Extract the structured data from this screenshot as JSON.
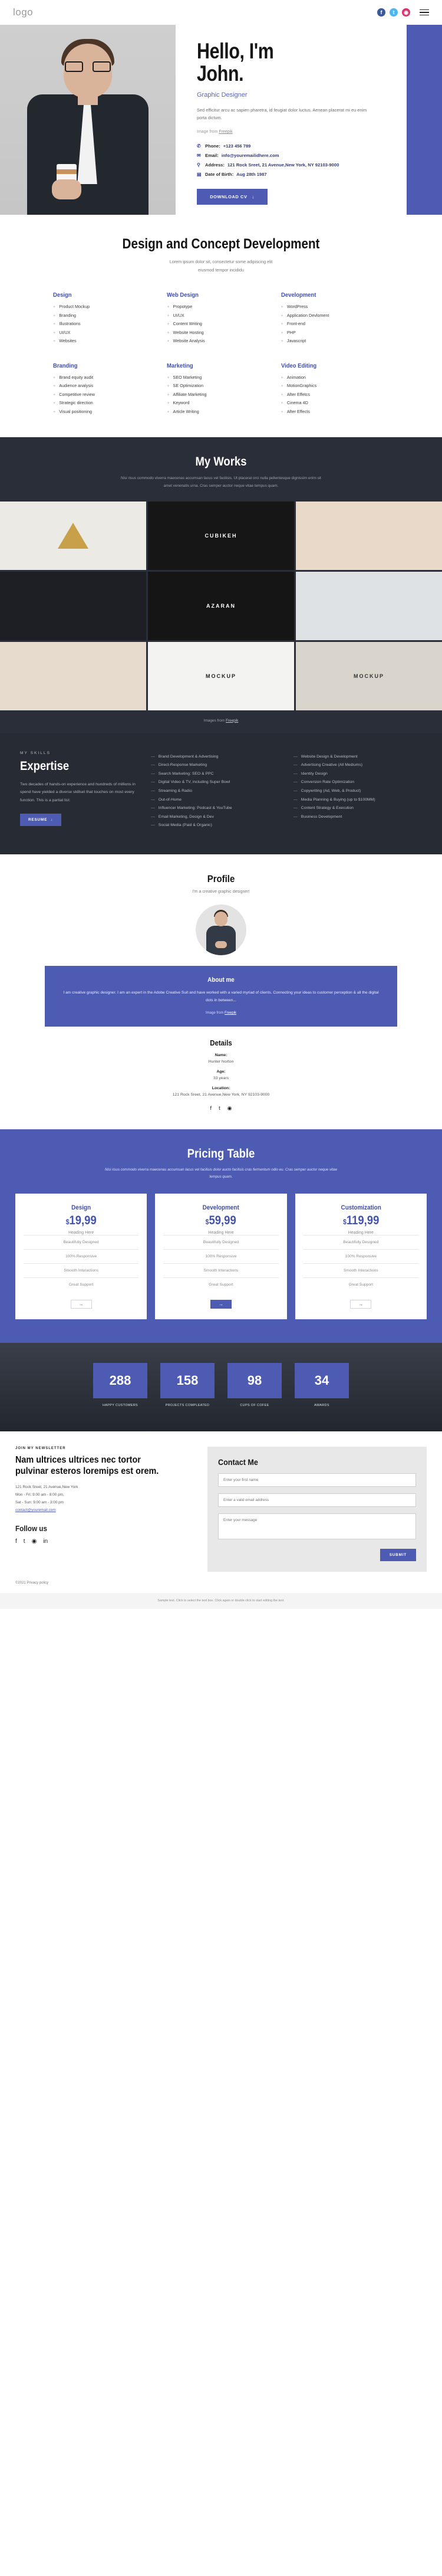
{
  "topbar": {
    "logo": "logo",
    "social": [
      {
        "name": "facebook",
        "glyph": "f"
      },
      {
        "name": "twitter",
        "glyph": "t"
      },
      {
        "name": "instagram",
        "glyph": "◉"
      }
    ],
    "menu_label": "menu"
  },
  "hero": {
    "title_line1": "Hello, I'm",
    "title_line2": "John.",
    "role": "Graphic Designer",
    "desc": "Sed efficitur arcu ac sapien pharetra, id feugiat dolor luctus. Aenean placerat mi eu enim porta dictum.",
    "credit_prefix": "Image from ",
    "credit_link": "Freepik",
    "contacts": [
      {
        "icon": "phone-icon",
        "glyph": "✆",
        "label": "Phone:",
        "value": "+123 456 789"
      },
      {
        "icon": "mail-icon",
        "glyph": "✉",
        "label": "Email:",
        "value": "info@youremailidhere.com"
      },
      {
        "icon": "pin-icon",
        "glyph": "⚲",
        "label": "Address:",
        "value": "121 Rock Sreet, 21 Avenue,New York, NY 92103-9000"
      },
      {
        "icon": "calendar-icon",
        "glyph": "▤",
        "label": "Date of Birth:",
        "value": "Aug 28th 1987"
      }
    ],
    "cta": "DOWNLOAD CV"
  },
  "services": {
    "title": "Design and Concept Development",
    "subtitle_line1": "Lorem ipsum dolor sit, consectetur some adipiscing elit",
    "subtitle_line2": "eiusmod tempor incididu",
    "groups": [
      {
        "heading": "Design",
        "items": [
          "Product Mockup",
          "Branding",
          "Illustrations",
          "UI/UX",
          "Websites"
        ]
      },
      {
        "heading": "Web Design",
        "items": [
          "Propotype",
          "UI/UX",
          "Content Writing",
          "Website Hosting",
          "Website Analysis"
        ]
      },
      {
        "heading": "Development",
        "items": [
          "WordPress",
          "Application Devloment",
          "Front-end",
          "PHP",
          "Javascript"
        ]
      },
      {
        "heading": "Branding",
        "items": [
          "Brand equity audit",
          "Audience analysis",
          "Competitive review",
          "Strategic direction",
          "Visual positioning"
        ]
      },
      {
        "heading": "Marketing",
        "items": [
          "SEO Marketing",
          "SE Optimization",
          "Affiliate Marketing",
          "Keyword",
          "Article Writing"
        ]
      },
      {
        "heading": "Video Editing",
        "items": [
          "Animation",
          "MotionGraphics",
          "After Effetcs",
          "Cinema 4D",
          "After Effects"
        ]
      }
    ]
  },
  "works": {
    "title": "My Works",
    "subtitle": "Nisi risus commodo viverra maecenas accumsan lacus vel facilisis. Ut placerat orci nulla pellentesque dignissim enim sit amet venenatis urna. Cras semper auctor neque vitae tempus quam.",
    "credit_prefix": "Images from ",
    "credit_link": "Freepik",
    "tiles": [
      {
        "name": "tile-logo-sketch",
        "caption": ""
      },
      {
        "name": "tile-cubikeh",
        "caption": "CUBIKEH"
      },
      {
        "name": "tile-leather-emboss",
        "caption": ""
      },
      {
        "name": "tile-business-cards",
        "caption": ""
      },
      {
        "name": "tile-azaran-signage",
        "caption": "AZARAN"
      },
      {
        "name": "tile-lion-badge",
        "caption": ""
      },
      {
        "name": "tile-card-mockup",
        "caption": ""
      },
      {
        "name": "tile-pen-mockup",
        "caption": "MOCKUP"
      },
      {
        "name": "tile-stationery-mockup",
        "caption": "MOCKUP"
      }
    ]
  },
  "expertise": {
    "kicker": "MY SKILLS",
    "heading": "Expertise",
    "paragraph": "Two decades of hands-on experience and hundreds of millions in spend have yielded a diverse skillset that touches on most every function. This is a partial list:",
    "button": "RESUME",
    "col_left": [
      "Brand Development & Advertising",
      "Direct-Response Marketing",
      "Search Marketing: SEO & PPC",
      "Digital Video & TV, including Super Bowl",
      "Streaming & Radio",
      "Out-of-Home",
      "Influencer Marketing: Podcast & YouTube",
      "Email Marketing, Design & Dev",
      "Social Media (Paid & Organic)"
    ],
    "col_right": [
      "Website Design & Development",
      "Advertising Creative (All Mediums)",
      "Identity Design",
      "Conversion Rate Optimization",
      "Copywriting (Ad, Web, & Product)",
      "Media Planning & Buying (up to $100MM)",
      "Content Strategy & Execution",
      "Business Development"
    ]
  },
  "profile": {
    "title": "Profile",
    "subtitle": "I'm a creative graphic designer!",
    "about_heading": "About me",
    "about_text": "I am creative graphic designer. I am an expert in the Adobe Creative Suit and have worked with a varied myriad of clients. Connecting your ideas to customer perception & all the digital dots in between...",
    "credit_prefix": "Image from ",
    "credit_link": "Freepik",
    "details_heading": "Details",
    "details": [
      {
        "key": "Name:",
        "value": "Hunter Norton"
      },
      {
        "key": "Age:",
        "value": "33 years"
      },
      {
        "key": "Location:",
        "value": "121 Rock Sreet, 21 Avenue,New York, NY 92103-9000"
      }
    ],
    "social": [
      {
        "name": "facebook-icon",
        "glyph": "f"
      },
      {
        "name": "twitter-icon",
        "glyph": "t"
      },
      {
        "name": "instagram-icon",
        "glyph": "◉"
      }
    ]
  },
  "pricing": {
    "title": "Pricing Table",
    "subtitle": "Nisi risus commodo viverra maecenas accumsan lacus vel facilisis dolor aucto facilisis cras fermentum odio eu. Cras semper auctor neque vitae tempus quam.",
    "plans": [
      {
        "name": "Design",
        "currency": "$",
        "price": "19,99",
        "heading": "Heading Here",
        "features": [
          "Beautifully Designed",
          "100% Responsive",
          "Smooth Interactions",
          "Great Support"
        ],
        "cta": "→"
      },
      {
        "name": "Development",
        "currency": "$",
        "price": "59,99",
        "heading": "Heading Here",
        "features": [
          "Beautifully Designed",
          "100% Responsive",
          "Smooth Interactions",
          "Great Support"
        ],
        "cta": "→"
      },
      {
        "name": "Customization",
        "currency": "$",
        "price": "119,99",
        "heading": "Heading Here",
        "features": [
          "Beautifully Designed",
          "100% Responsive",
          "Smooth Interactions",
          "Great Support"
        ],
        "cta": "→"
      }
    ]
  },
  "counters": [
    {
      "value": "288",
      "label": "HAPPY CUSTOMERS"
    },
    {
      "value": "158",
      "label": "PROJECTS COMPLEATED"
    },
    {
      "value": "98",
      "label": "CUPS OF COFEE"
    },
    {
      "value": "34",
      "label": "AWARDS"
    }
  ],
  "footer": {
    "kicker": "JOIN MY NEWSLETTER",
    "heading": "Nam ultrices ultrices nec tortor pulvinar esteros loremips est orem.",
    "address_line1": "121 Rock Sreet, 21 Avenue,New York",
    "address_line2": "Mon - Fri: 9:00 am - 8:00 pm,",
    "address_line3": "Sat - Sun: 9:00 am - 3:00 pm",
    "email": "contact@youremail.com",
    "follow_heading": "Follow us",
    "social": [
      {
        "name": "facebook-icon",
        "glyph": "f"
      },
      {
        "name": "twitter-icon",
        "glyph": "t"
      },
      {
        "name": "instagram-icon",
        "glyph": "◉"
      },
      {
        "name": "linkedin-icon",
        "glyph": "in"
      }
    ],
    "contact_heading": "Contact Me",
    "name_placeholder": "Enter your first name",
    "email_placeholder": "Enter a valid email address",
    "message_placeholder": "Enter your message",
    "submit_label": "SUBMIT",
    "copyright": "©2021 Privacy policy"
  },
  "strip": {
    "line1_prefix": "Sample text. Click to select the text box. Click again or double click to start editing the text.",
    "line2": ""
  },
  "colors": {
    "accent": "#4d5bb3",
    "dark": "#2a2e38",
    "darker": "#272b34"
  }
}
